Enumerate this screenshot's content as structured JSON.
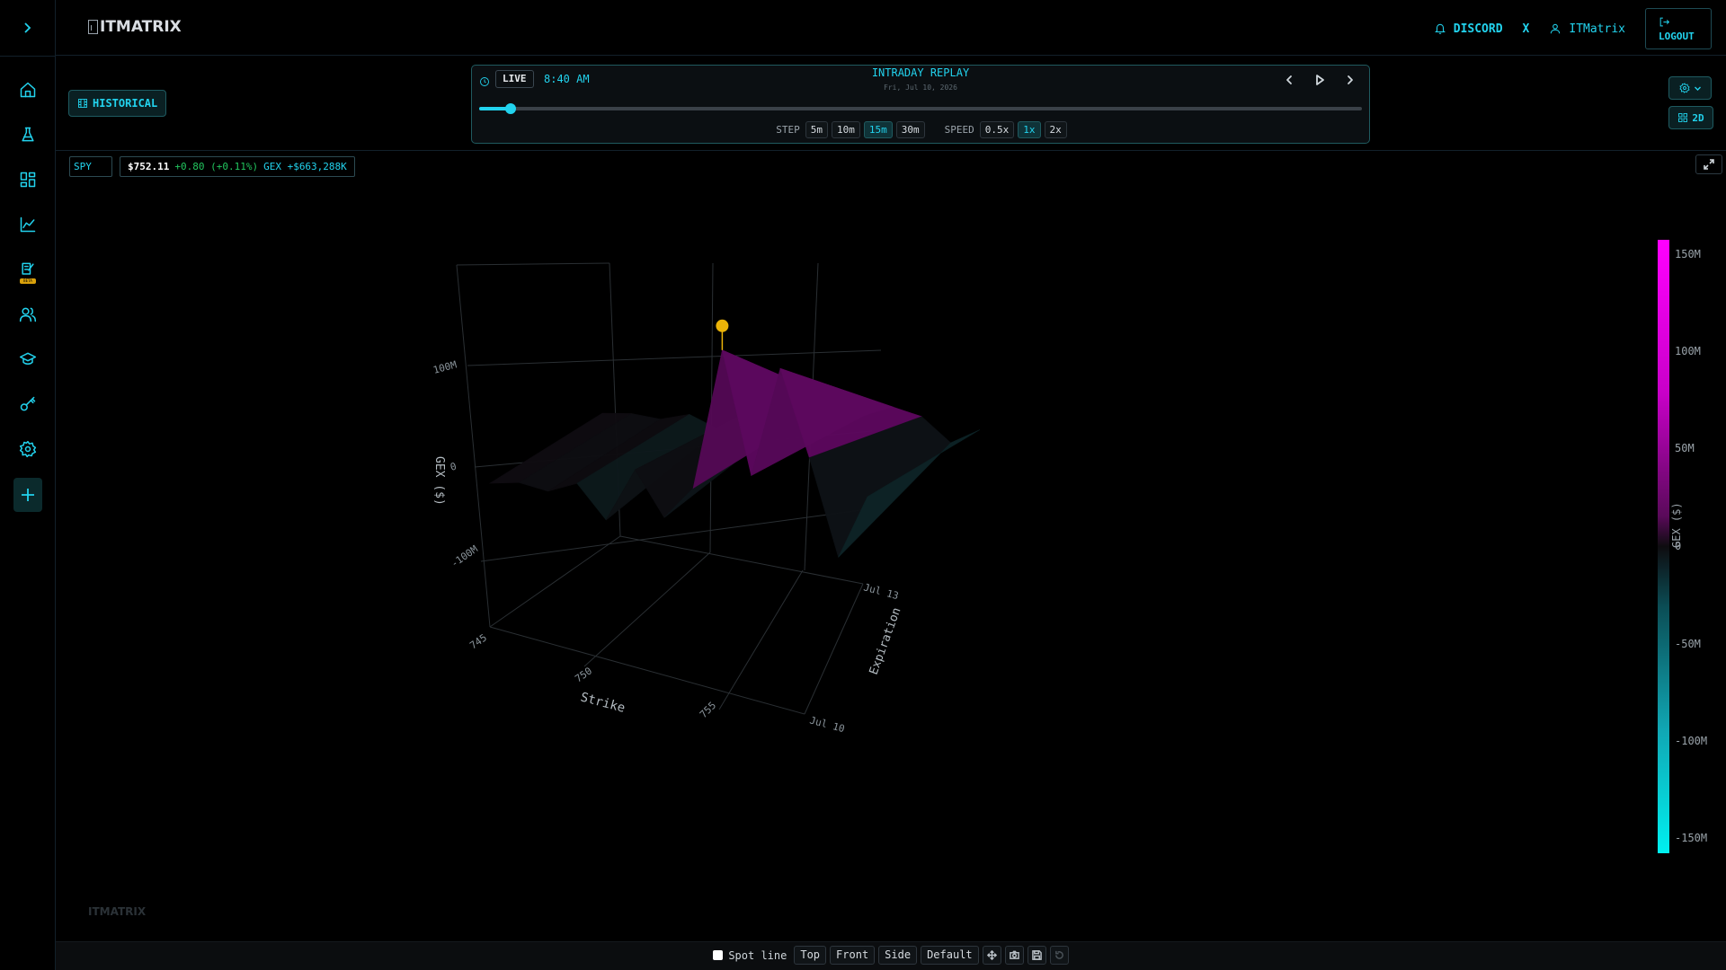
{
  "brand": {
    "name": "ITMATRIX",
    "watermark": "ITMATRIX"
  },
  "topbar": {
    "discord": "DISCORD",
    "x": "X",
    "user": "ITMatrix",
    "logout": "LOGOUT"
  },
  "sidebar": {
    "items": [
      {
        "icon": "home-icon"
      },
      {
        "icon": "flask-icon"
      },
      {
        "icon": "dashboard-icon"
      },
      {
        "icon": "chart-icon"
      },
      {
        "icon": "notes-beta-icon",
        "badge": "BETA"
      },
      {
        "icon": "users-icon"
      },
      {
        "icon": "graduation-cap-icon"
      },
      {
        "icon": "key-icon"
      },
      {
        "icon": "settings-icon"
      },
      {
        "icon": "plus-icon"
      }
    ]
  },
  "historical": {
    "label": "HISTORICAL"
  },
  "replay": {
    "live": "LIVE",
    "time": "8:40 AM",
    "title": "INTRADAY REPLAY",
    "date": "Fri, Jul 10, 2026",
    "progress": 0.036,
    "step_label": "STEP",
    "steps": [
      "5m",
      "10m",
      "15m",
      "30m"
    ],
    "step_active": "15m",
    "speed_label": "SPEED",
    "speeds": [
      "0.5x",
      "1x",
      "2x"
    ],
    "speed_active": "1x"
  },
  "view": {
    "mode_label": "2D"
  },
  "quote": {
    "ticker": "SPY",
    "price": "$752.11",
    "change": "+0.80 (+0.11%)",
    "gex": "GEX +$663,288K"
  },
  "chart_data": {
    "type": "surface3d",
    "title": "",
    "zlabel": "GEX ($)",
    "xlabel": "Strike",
    "ylabel": "Expiration",
    "x_ticks": [
      "745",
      "750",
      "755"
    ],
    "y_ticks": [
      "Jul 10",
      "Jul 13"
    ],
    "z_ticks": [
      "-100M",
      "0",
      "100M"
    ],
    "zlim": [
      -150,
      150
    ],
    "z_unit": "M",
    "colorbar": {
      "title": "GEX ($)",
      "ticks": [
        "150M",
        "100M",
        "50M",
        "0",
        "-50M",
        "-100M",
        "-150M"
      ],
      "colorscale": [
        "#00f0f0",
        "#0e0c10",
        "#ff00ff"
      ]
    },
    "strikes": [
      744,
      745,
      746,
      747,
      748,
      749,
      750,
      751,
      752,
      753,
      754,
      755,
      756,
      757
    ],
    "expirations": [
      "Jul 10",
      "Jul 13"
    ],
    "gex_by_expiration": [
      [
        0,
        2,
        -5,
        4,
        -30,
        20,
        -25,
        5,
        140,
        20,
        125,
        40,
        -55,
        5
      ],
      [
        0,
        1,
        -3,
        3,
        -10,
        8,
        -8,
        4,
        25,
        10,
        20,
        12,
        -12,
        2
      ]
    ],
    "spot_marker": {
      "strike": 752,
      "gex": 150
    }
  },
  "bottom": {
    "spot_line": "Spot line",
    "views": [
      "Top",
      "Front",
      "Side",
      "Default"
    ]
  }
}
